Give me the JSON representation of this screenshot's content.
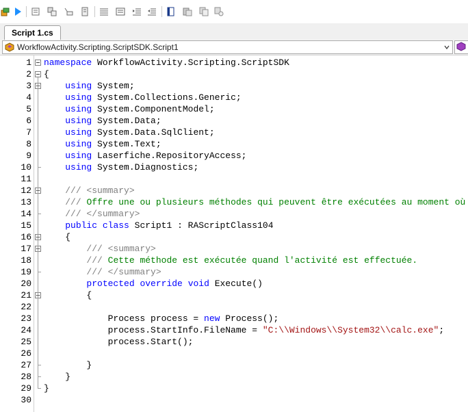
{
  "toolbar": {
    "buttons": [
      "build-icon",
      "run-icon",
      "insert-reference-icon",
      "add-reference-icon",
      "remove-reference-icon",
      "project-icon",
      "comment-icon",
      "uncomment-icon",
      "indent-icon",
      "outdent-icon",
      "copy-page-icon",
      "paste-icon",
      "duplicate-icon",
      "settings-icon"
    ]
  },
  "tab": {
    "label": "Script 1.cs"
  },
  "class_combo": {
    "value": "WorkflowActivity.Scripting.ScriptSDK.Script1"
  },
  "lines": [
    {
      "n": "1",
      "fold": "open",
      "tokens": [
        {
          "t": "namespace",
          "c": "kw"
        },
        {
          "t": " WorkflowActivity.Scripting.ScriptSDK"
        }
      ]
    },
    {
      "n": "2",
      "fold": "open",
      "tokens": [
        {
          "t": "{"
        }
      ]
    },
    {
      "n": "3",
      "fold": "open",
      "tokens": [
        {
          "t": "    "
        },
        {
          "t": "using",
          "c": "kw"
        },
        {
          "t": " System;"
        }
      ]
    },
    {
      "n": "4",
      "tokens": [
        {
          "t": "    "
        },
        {
          "t": "using",
          "c": "kw"
        },
        {
          "t": " System.Collections.Generic;"
        }
      ]
    },
    {
      "n": "5",
      "tokens": [
        {
          "t": "    "
        },
        {
          "t": "using",
          "c": "kw"
        },
        {
          "t": " System.ComponentModel;"
        }
      ]
    },
    {
      "n": "6",
      "tokens": [
        {
          "t": "    "
        },
        {
          "t": "using",
          "c": "kw"
        },
        {
          "t": " System.Data;"
        }
      ]
    },
    {
      "n": "7",
      "tokens": [
        {
          "t": "    "
        },
        {
          "t": "using",
          "c": "kw"
        },
        {
          "t": " System.Data.SqlClient;"
        }
      ]
    },
    {
      "n": "8",
      "tokens": [
        {
          "t": "    "
        },
        {
          "t": "using",
          "c": "kw"
        },
        {
          "t": " System.Text;"
        }
      ]
    },
    {
      "n": "9",
      "tokens": [
        {
          "t": "    "
        },
        {
          "t": "using",
          "c": "kw"
        },
        {
          "t": " Laserfiche.RepositoryAccess;"
        }
      ]
    },
    {
      "n": "10",
      "tokens": [
        {
          "t": "    "
        },
        {
          "t": "using",
          "c": "kw"
        },
        {
          "t": " System.Diagnostics;"
        }
      ]
    },
    {
      "n": "11",
      "tokens": []
    },
    {
      "n": "12",
      "fold": "open",
      "tokens": [
        {
          "t": "    "
        },
        {
          "t": "/// <summary>",
          "c": "dc"
        }
      ]
    },
    {
      "n": "13",
      "tokens": [
        {
          "t": "    "
        },
        {
          "t": "/// ",
          "c": "dc"
        },
        {
          "t": "Offre une ou plusieurs méthodes qui peuvent être exécutées au moment où",
          "c": "cm"
        }
      ]
    },
    {
      "n": "14",
      "tokens": [
        {
          "t": "    "
        },
        {
          "t": "/// </summary>",
          "c": "dc"
        }
      ]
    },
    {
      "n": "15",
      "tokens": [
        {
          "t": "    "
        },
        {
          "t": "public",
          "c": "kw"
        },
        {
          "t": " "
        },
        {
          "t": "class",
          "c": "kw"
        },
        {
          "t": " Script1 : RAScriptClass104"
        }
      ]
    },
    {
      "n": "16",
      "fold": "open",
      "tokens": [
        {
          "t": "    {"
        }
      ]
    },
    {
      "n": "17",
      "fold": "open",
      "tokens": [
        {
          "t": "        "
        },
        {
          "t": "/// <summary>",
          "c": "dc"
        }
      ]
    },
    {
      "n": "18",
      "tokens": [
        {
          "t": "        "
        },
        {
          "t": "/// ",
          "c": "dc"
        },
        {
          "t": "Cette méthode est exécutée quand l'activité est effectuée.",
          "c": "cm"
        }
      ]
    },
    {
      "n": "19",
      "tokens": [
        {
          "t": "        "
        },
        {
          "t": "/// </summary>",
          "c": "dc"
        }
      ]
    },
    {
      "n": "20",
      "tokens": [
        {
          "t": "        "
        },
        {
          "t": "protected",
          "c": "kw"
        },
        {
          "t": " "
        },
        {
          "t": "override",
          "c": "kw"
        },
        {
          "t": " "
        },
        {
          "t": "void",
          "c": "kw"
        },
        {
          "t": " Execute()"
        }
      ]
    },
    {
      "n": "21",
      "fold": "open",
      "tokens": [
        {
          "t": "        {"
        }
      ]
    },
    {
      "n": "22",
      "tokens": []
    },
    {
      "n": "23",
      "tokens": [
        {
          "t": "            Process process = "
        },
        {
          "t": "new",
          "c": "kw"
        },
        {
          "t": " Process();"
        }
      ]
    },
    {
      "n": "24",
      "tokens": [
        {
          "t": "            process.StartInfo.FileName = "
        },
        {
          "t": "\"C:\\\\Windows\\\\System32\\\\calc.exe\"",
          "c": "st"
        },
        {
          "t": ";"
        }
      ]
    },
    {
      "n": "25",
      "tokens": [
        {
          "t": "            process.Start();"
        }
      ]
    },
    {
      "n": "26",
      "tokens": []
    },
    {
      "n": "27",
      "tokens": [
        {
          "t": "        }"
        }
      ]
    },
    {
      "n": "28",
      "tokens": [
        {
          "t": "    }"
        }
      ]
    },
    {
      "n": "29",
      "tokens": [
        {
          "t": "}"
        }
      ]
    },
    {
      "n": "30",
      "tokens": []
    }
  ]
}
